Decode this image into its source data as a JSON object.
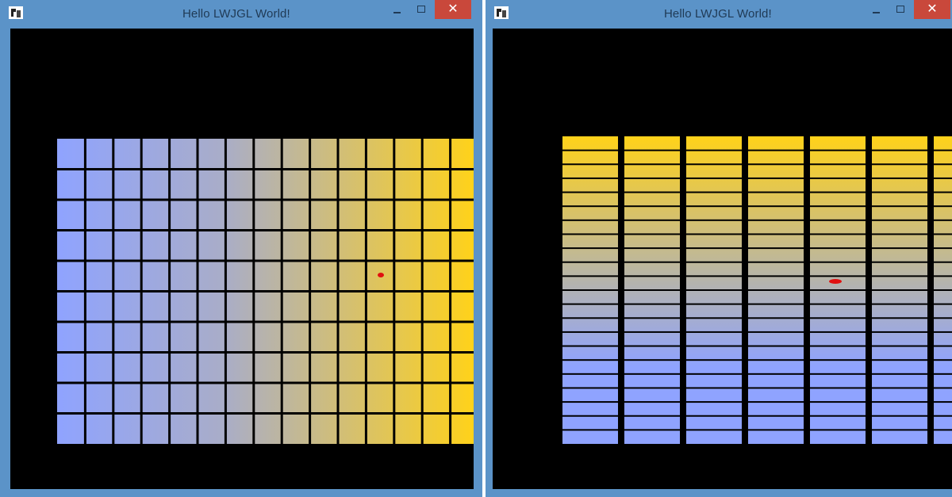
{
  "windows": [
    {
      "title": "Hello LWJGL World!",
      "close_glyph": "✕",
      "icons": {
        "app": "java-duke-icon",
        "minimize": "minimize-icon",
        "maximize": "maximize-icon",
        "close": "close-icon"
      },
      "grid": {
        "columns": 15,
        "rows": 10,
        "gradient": "horizontal"
      }
    },
    {
      "title": "Hello LWJGL World!",
      "close_glyph": "✕",
      "icons": {
        "app": "java-duke-icon",
        "minimize": "minimize-icon",
        "maximize": "maximize-icon",
        "close": "close-icon"
      },
      "grid": {
        "columns": 7,
        "rows": 22,
        "gradient": "vertical"
      }
    }
  ],
  "colors": {
    "titlebar": "#5b93c8",
    "close_button": "#c9483b",
    "background": "#000000",
    "gradient_blue": "#8fa3ff",
    "gradient_yellow": "#ffd21a",
    "cursor_marker": "#e01010"
  }
}
